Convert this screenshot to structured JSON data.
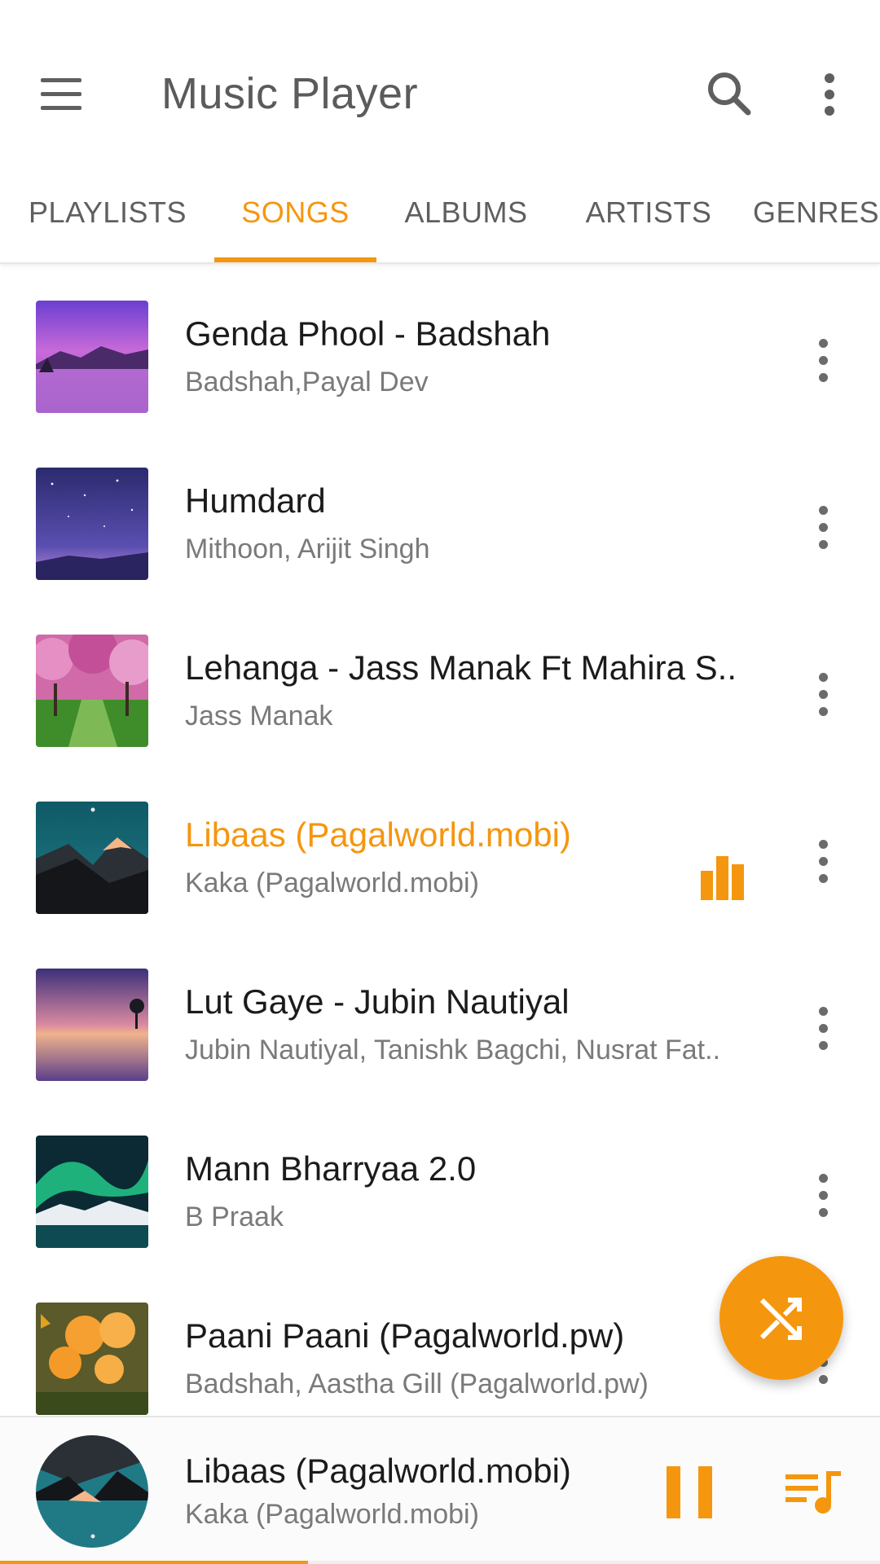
{
  "appbar": {
    "title": "Music Player",
    "icons": [
      "hamburger-menu-icon",
      "search-icon",
      "more-vert-icon"
    ]
  },
  "tabs": [
    {
      "label": "PLAYLISTS",
      "active": false
    },
    {
      "label": "SONGS",
      "active": true
    },
    {
      "label": "ALBUMS",
      "active": false
    },
    {
      "label": "ARTISTS",
      "active": false
    },
    {
      "label": "GENRES",
      "active": false
    }
  ],
  "songs": [
    {
      "title": "Genda Phool - Badshah",
      "artist": "Badshah,Payal Dev",
      "playing": false,
      "art": "purple-lake-landscape"
    },
    {
      "title": "Humdard",
      "artist": "Mithoon, Arijit Singh",
      "playing": false,
      "art": "starry-night-sky"
    },
    {
      "title": "Lehanga - Jass Manak Ft Mahira S..",
      "artist": "Jass Manak",
      "playing": false,
      "art": "cherry-blossom-path"
    },
    {
      "title": "Libaas (Pagalworld.mobi)",
      "artist": "Kaka (Pagalworld.mobi)",
      "playing": true,
      "art": "snowy-mountain-night"
    },
    {
      "title": "Lut Gaye - Jubin Nautiyal",
      "artist": "Jubin Nautiyal, Tanishk Bagchi, Nusrat Fat..",
      "playing": false,
      "art": "sunset-lake"
    },
    {
      "title": "Mann Bharryaa 2.0",
      "artist": "B Praak",
      "playing": false,
      "art": "aurora-mountains"
    },
    {
      "title": "Paani Paani (Pagalworld.pw)",
      "artist": "Badshah, Aastha Gill (Pagalworld.pw)",
      "playing": false,
      "art": "orange-flowers-butterfly"
    }
  ],
  "fab": {
    "icon": "shuffle-icon"
  },
  "now_playing": {
    "title": "Libaas (Pagalworld.mobi)",
    "artist": "Kaka (Pagalworld.mobi)",
    "progress_percent": 35,
    "icons": [
      "pause-icon",
      "queue-music-icon"
    ]
  },
  "colors": {
    "accent": "#f5960f",
    "primary_text": "#1b1b1b",
    "secondary_text": "#7a7a7a"
  }
}
